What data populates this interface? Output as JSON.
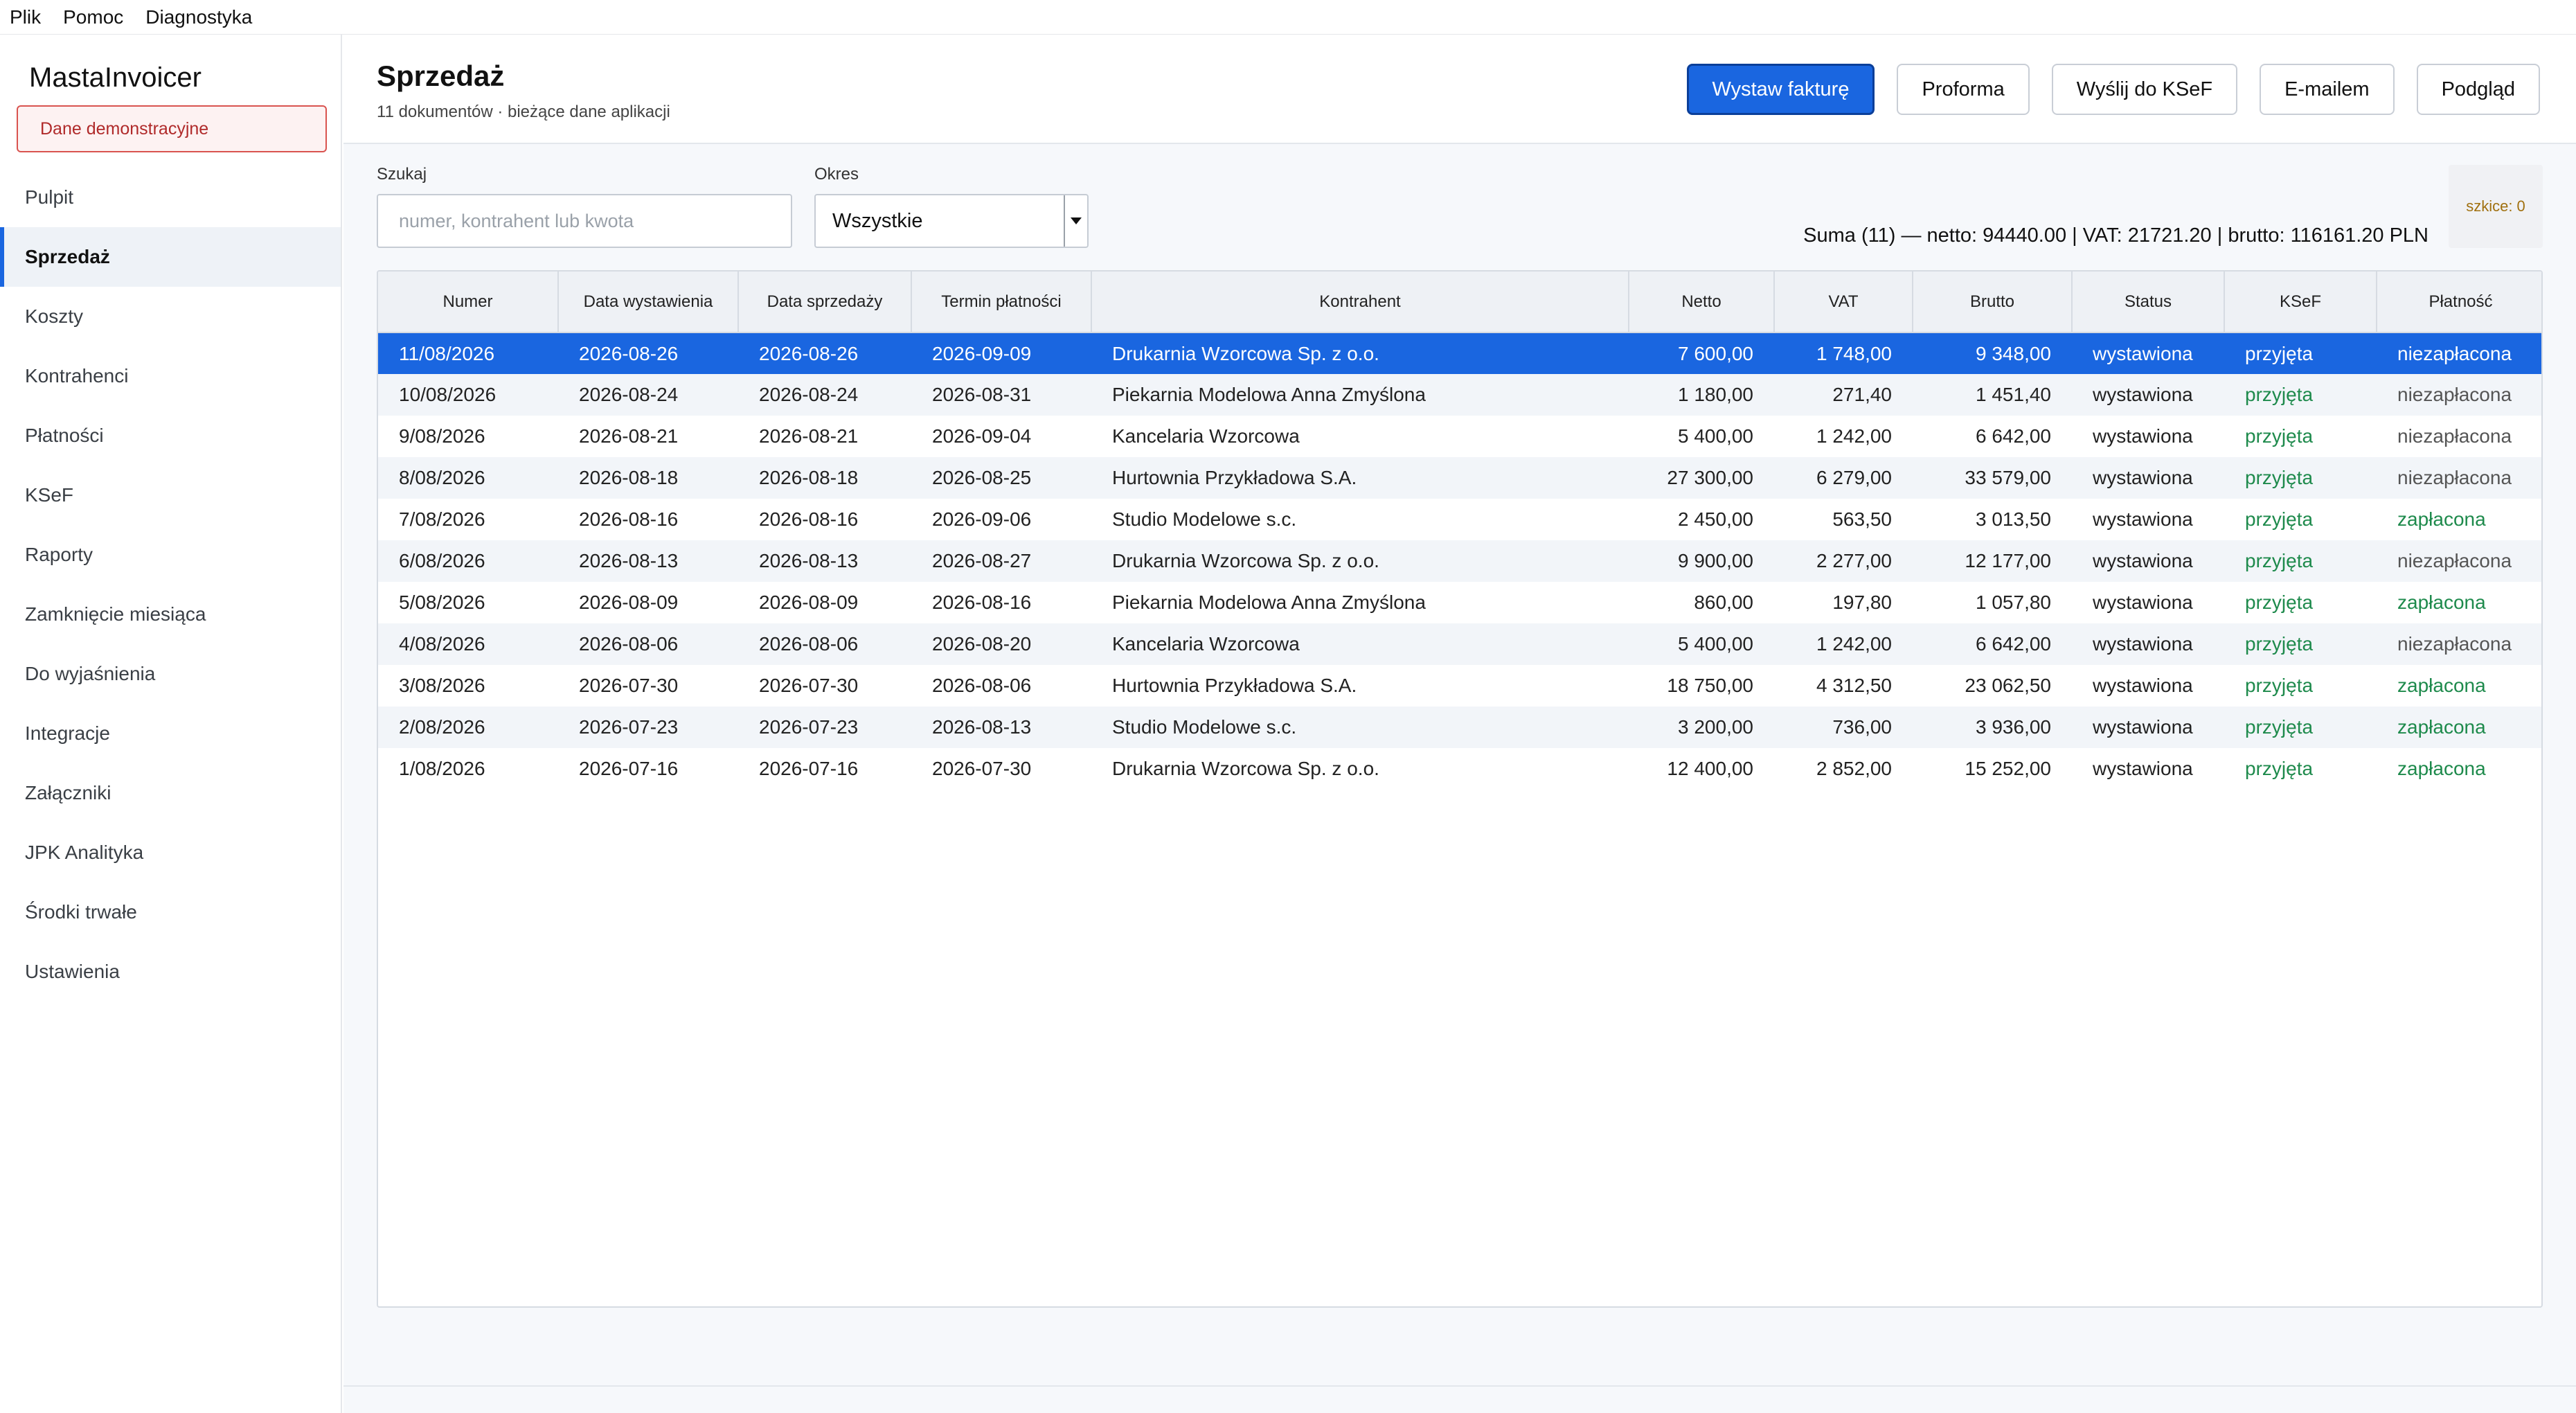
{
  "menubar": {
    "items": [
      "Plik",
      "Pomoc",
      "Diagnostyka"
    ]
  },
  "sidebar": {
    "brand": "MastaInvoicer",
    "demo_badge": "Dane demonstracyjne",
    "items": [
      {
        "label": "Pulpit",
        "active": false
      },
      {
        "label": "Sprzedaż",
        "active": true
      },
      {
        "label": "Koszty",
        "active": false
      },
      {
        "label": "Kontrahenci",
        "active": false
      },
      {
        "label": "Płatności",
        "active": false
      },
      {
        "label": "KSeF",
        "active": false
      },
      {
        "label": "Raporty",
        "active": false
      },
      {
        "label": "Zamknięcie miesiąca",
        "active": false
      },
      {
        "label": "Do wyjaśnienia",
        "active": false
      },
      {
        "label": "Integracje",
        "active": false
      },
      {
        "label": "Załączniki",
        "active": false
      },
      {
        "label": "JPK Analityka",
        "active": false
      },
      {
        "label": "Środki trwałe",
        "active": false
      },
      {
        "label": "Ustawienia",
        "active": false
      }
    ]
  },
  "header": {
    "title": "Sprzedaż",
    "subtitle": "11 dokumentów · bieżące dane aplikacji",
    "buttons": {
      "issue": "Wystaw fakturę",
      "proforma": "Proforma",
      "ksef": "Wyślij do KSeF",
      "email": "E-mailem",
      "preview": "Podgląd"
    }
  },
  "filters": {
    "search_label": "Szukaj",
    "search_placeholder": "numer, kontrahent lub kwota",
    "search_value": "",
    "period_label": "Okres",
    "period_value": "Wszystkie"
  },
  "summary": "Suma (11) — netto: 94440.00  |  VAT: 21721.20  |  brutto: 116161.20 PLN",
  "drafts": "szkice: 0",
  "colors": {
    "accent": "#1a66e0",
    "ok": "#1e8a4c",
    "demo": "#b02a2a",
    "drafts": "#a0700f"
  },
  "table": {
    "columns": [
      "Numer",
      "Data wystawienia",
      "Data sprzedaży",
      "Termin płatności",
      "Kontrahent",
      "Netto",
      "VAT",
      "Brutto",
      "Status",
      "KSeF",
      "Płatność"
    ],
    "rows": [
      [
        "11/08/2026",
        "2026-08-26",
        "2026-08-26",
        "2026-09-09",
        "Drukarnia Wzorcowa Sp. z o.o.",
        "7 600,00",
        "1 748,00",
        "9 348,00",
        "wystawiona",
        "przyjęta",
        "niezapłacona"
      ],
      [
        "10/08/2026",
        "2026-08-24",
        "2026-08-24",
        "2026-08-31",
        "Piekarnia Modelowa Anna Zmyślona",
        "1 180,00",
        "271,40",
        "1 451,40",
        "wystawiona",
        "przyjęta",
        "niezapłacona"
      ],
      [
        "9/08/2026",
        "2026-08-21",
        "2026-08-21",
        "2026-09-04",
        "Kancelaria Wzorcowa",
        "5 400,00",
        "1 242,00",
        "6 642,00",
        "wystawiona",
        "przyjęta",
        "niezapłacona"
      ],
      [
        "8/08/2026",
        "2026-08-18",
        "2026-08-18",
        "2026-08-25",
        "Hurtownia Przykładowa S.A.",
        "27 300,00",
        "6 279,00",
        "33 579,00",
        "wystawiona",
        "przyjęta",
        "niezapłacona"
      ],
      [
        "7/08/2026",
        "2026-08-16",
        "2026-08-16",
        "2026-09-06",
        "Studio Modelowe s.c.",
        "2 450,00",
        "563,50",
        "3 013,50",
        "wystawiona",
        "przyjęta",
        "zapłacona"
      ],
      [
        "6/08/2026",
        "2026-08-13",
        "2026-08-13",
        "2026-08-27",
        "Drukarnia Wzorcowa Sp. z o.o.",
        "9 900,00",
        "2 277,00",
        "12 177,00",
        "wystawiona",
        "przyjęta",
        "niezapłacona"
      ],
      [
        "5/08/2026",
        "2026-08-09",
        "2026-08-09",
        "2026-08-16",
        "Piekarnia Modelowa Anna Zmyślona",
        "860,00",
        "197,80",
        "1 057,80",
        "wystawiona",
        "przyjęta",
        "zapłacona"
      ],
      [
        "4/08/2026",
        "2026-08-06",
        "2026-08-06",
        "2026-08-20",
        "Kancelaria Wzorcowa",
        "5 400,00",
        "1 242,00",
        "6 642,00",
        "wystawiona",
        "przyjęta",
        "niezapłacona"
      ],
      [
        "3/08/2026",
        "2026-07-30",
        "2026-07-30",
        "2026-08-06",
        "Hurtownia Przykładowa S.A.",
        "18 750,00",
        "4 312,50",
        "23 062,50",
        "wystawiona",
        "przyjęta",
        "zapłacona"
      ],
      [
        "2/08/2026",
        "2026-07-23",
        "2026-07-23",
        "2026-08-13",
        "Studio Modelowe s.c.",
        "3 200,00",
        "736,00",
        "3 936,00",
        "wystawiona",
        "przyjęta",
        "zapłacona"
      ],
      [
        "1/08/2026",
        "2026-07-16",
        "2026-07-16",
        "2026-07-30",
        "Drukarnia Wzorcowa Sp. z o.o.",
        "12 400,00",
        "2 852,00",
        "15 252,00",
        "wystawiona",
        "przyjęta",
        "zapłacona"
      ]
    ],
    "selected_row": 0
  }
}
